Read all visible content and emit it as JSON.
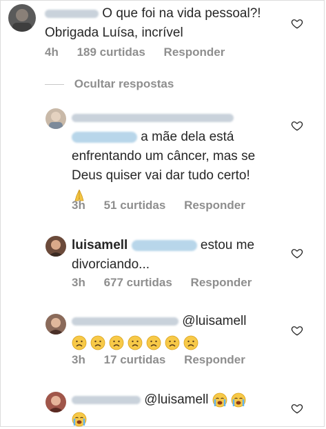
{
  "comments": [
    {
      "id": "c1",
      "text_line1": "O que foi na vida pessoal?!",
      "text_line2": "Obrigada Luísa, incrível",
      "time": "4h",
      "likes": "189 curtidas",
      "reply": "Responder"
    },
    {
      "id": "c2",
      "text_line1": "a mãe dela está",
      "text_line2": "enfrentando um câncer, mas se",
      "text_line3": "Deus quiser vai dar tudo certo!",
      "time": "3h",
      "likes": "51 curtidas",
      "reply": "Responder"
    },
    {
      "id": "c3",
      "username": "luisamell",
      "text_line1": "estou me",
      "text_line2": "divorciando...",
      "time": "3h",
      "likes": "677 curtidas",
      "reply": "Responder"
    },
    {
      "id": "c4",
      "mention": "@luisamell",
      "time": "3h",
      "likes": "17 curtidas",
      "reply": "Responder"
    },
    {
      "id": "c5",
      "mention": "@luisamell"
    }
  ],
  "hide_replies": "Ocultar respostas",
  "icons": {
    "like": "heart-outline-icon",
    "pray": "folded-hands-emoji",
    "frown": "frowning-face-emoji",
    "cry": "crying-face-emoji"
  },
  "colors": {
    "text": "#262626",
    "meta": "#8e8e8e",
    "mention_blur": "#b8d6ea"
  }
}
